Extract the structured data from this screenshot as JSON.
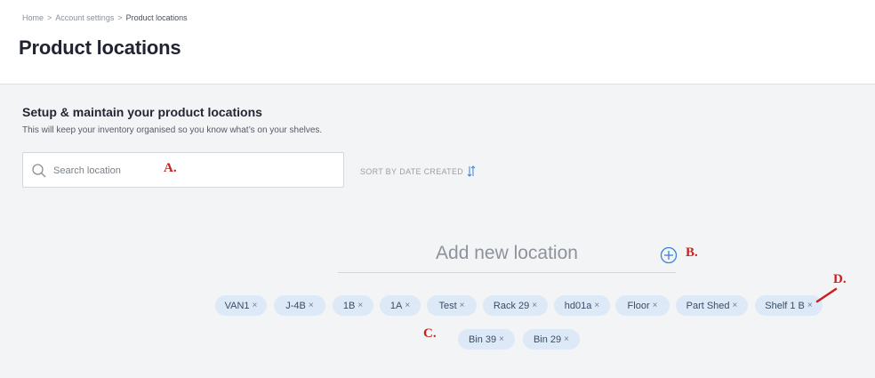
{
  "breadcrumb": {
    "home": "Home",
    "account": "Account settings",
    "current": "Product locations",
    "separator": ">"
  },
  "page": {
    "title": "Product locations"
  },
  "section": {
    "title": "Setup & maintain your product locations",
    "description": "This will keep your inventory organised so you know what’s on your shelves."
  },
  "search": {
    "placeholder": "Search location",
    "value": ""
  },
  "sort": {
    "label": "SORT BY",
    "value": "DATE CREATED"
  },
  "add": {
    "placeholder": "Add new location"
  },
  "tags": [
    "VAN1",
    "J-4B",
    "1B",
    "1A",
    "Test",
    "Rack 29",
    "hd01a",
    "Floor",
    "Part Shed",
    "Shelf 1 B",
    "Bin 39",
    "Bin 29"
  ],
  "tag_remove_glyph": "×",
  "annotations": {
    "a": "A.",
    "b": "B.",
    "c": "C.",
    "d": "D."
  },
  "colors": {
    "accent": "#3b82d9",
    "tag_bg": "#dde9f7",
    "annotation": "#cc1f1f"
  }
}
